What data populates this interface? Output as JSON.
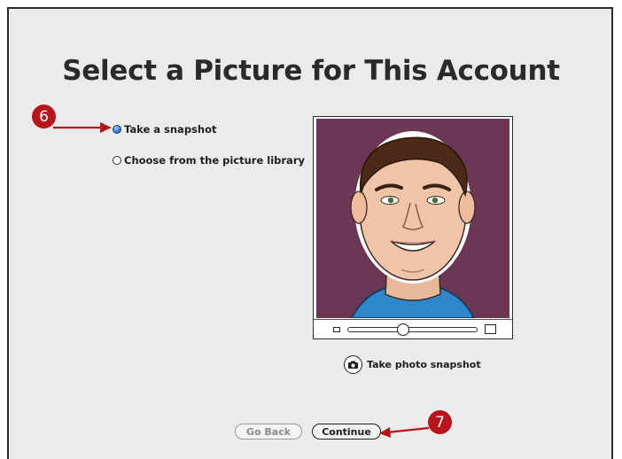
{
  "window": {
    "title": "Select a Picture for This Account"
  },
  "options": [
    {
      "label": "Take a snapshot",
      "selected": true
    },
    {
      "label": "Choose from the picture library",
      "selected": false
    }
  ],
  "photo": {
    "background_color": "#6b3755",
    "zoom_level": 0.42
  },
  "snapshot": {
    "label": "Take photo snapshot",
    "icon": "camera-icon"
  },
  "buttons": {
    "go_back": "Go Back",
    "continue": "Continue"
  },
  "callouts": [
    "6",
    "7"
  ],
  "colors": {
    "callout": "#b8141b",
    "radio_selected": "#3e7fd2"
  }
}
